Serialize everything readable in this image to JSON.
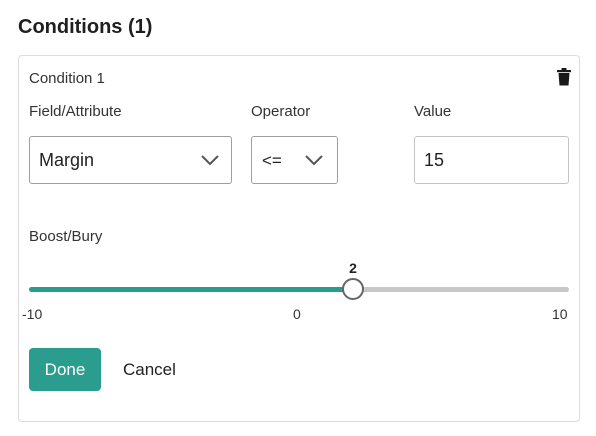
{
  "section": {
    "title": "Conditions (1)"
  },
  "condition": {
    "title": "Condition 1",
    "delete_icon": "trash-icon",
    "field": {
      "label": "Field/Attribute",
      "value": "Margin"
    },
    "operator": {
      "label": "Operator",
      "value": "<="
    },
    "value": {
      "label": "Value",
      "value": "15"
    },
    "boost": {
      "label": "Boost/Bury",
      "min": -10,
      "max": 10,
      "value": 2,
      "value_text": "2",
      "min_text": "-10",
      "mid_text": "0",
      "max_text": "10"
    }
  },
  "actions": {
    "done": "Done",
    "cancel": "Cancel"
  },
  "colors": {
    "accent": "#2a9d8f",
    "rail": "#c8c8c8"
  }
}
